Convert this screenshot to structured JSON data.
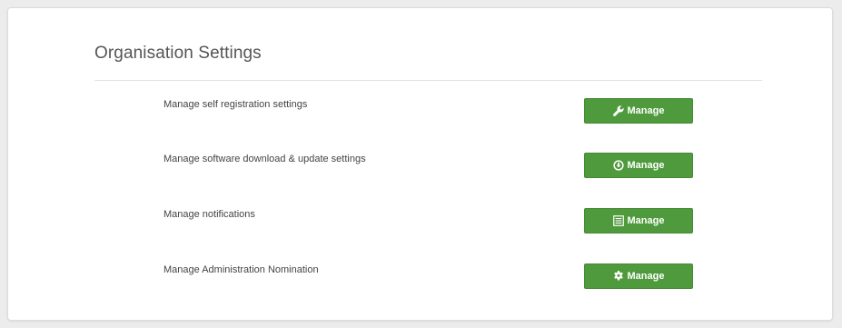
{
  "page": {
    "title": "Organisation Settings"
  },
  "settings": [
    {
      "label": "Manage self registration settings",
      "button_label": "Manage",
      "icon": "wrench-icon"
    },
    {
      "label": "Manage software download & update settings",
      "button_label": "Manage",
      "icon": "download-circle-icon"
    },
    {
      "label": "Manage notifications",
      "button_label": "Manage",
      "icon": "list-icon"
    },
    {
      "label": "Manage Administration Nomination",
      "button_label": "Manage",
      "icon": "gear-icon"
    }
  ],
  "colors": {
    "button_bg": "#4f9a3c",
    "button_text": "#ffffff",
    "page_bg": "#ececec",
    "card_bg": "#ffffff"
  }
}
